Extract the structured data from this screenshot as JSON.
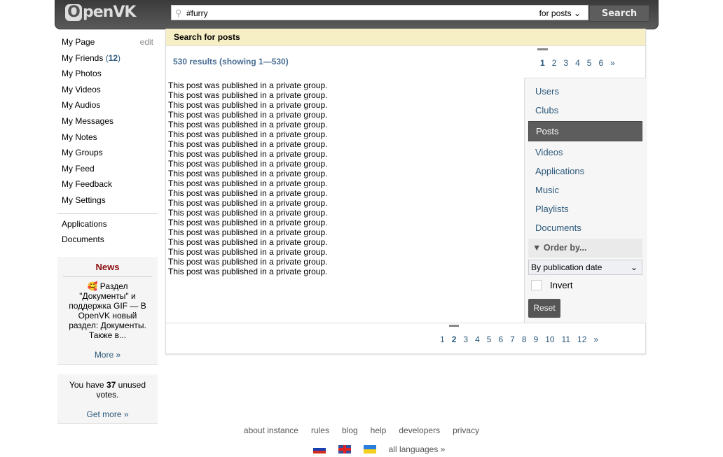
{
  "header": {
    "logo": "OpenVK",
    "search_value": "#furry",
    "search_scope": "for posts",
    "search_button": "Search"
  },
  "sidebar": {
    "items": [
      "My Page",
      "My Friends",
      "My Photos",
      "My Videos",
      "My Audios",
      "My Messages",
      "My Notes",
      "My Groups",
      "My Feed",
      "My Feedback",
      "My Settings"
    ],
    "edit": "edit",
    "friends_count": "12",
    "extra": [
      "Applications",
      "Documents"
    ]
  },
  "news": {
    "title": "News",
    "text": "🥰 Раздел \"Документы\" и поддержка GIF — В OpenVK новый раздел: Документы. Также в...",
    "more": "More »"
  },
  "votes": {
    "prefix": "You have",
    "count": "37",
    "suffix": "unused votes.",
    "more": "Get more »"
  },
  "main": {
    "title": "Search for posts",
    "count": "530 results (showing 1—530)",
    "top_pager": [
      "1",
      "2",
      "3",
      "4",
      "5",
      "6",
      "»"
    ],
    "top_current": "1",
    "bottom_pager": [
      "1",
      "2",
      "3",
      "4",
      "5",
      "6",
      "7",
      "8",
      "9",
      "10",
      "11",
      "12",
      "»"
    ],
    "bottom_current": "2",
    "posts": [
      "This post was published in a private group.",
      "This post was published in a private group.",
      "This post was published in a private group.",
      "This post was published in a private group.",
      "This post was published in a private group.",
      "This post was published in a private group.",
      "This post was published in a private group.",
      "This post was published in a private group.",
      "This post was published in a private group.",
      "This post was published in a private group.",
      "This post was published in a private group.",
      "This post was published in a private group.",
      "This post was published in a private group.",
      "This post was published in a private group.",
      "This post was published in a private group.",
      "This post was published in a private group.",
      "This post was published in a private group.",
      "This post was published in a private group.",
      "This post was published in a private group.",
      "This post was published in a private group."
    ]
  },
  "rnav": {
    "items": [
      "Users",
      "Clubs",
      "Posts",
      "Videos",
      "Applications",
      "Music",
      "Playlists",
      "Documents"
    ],
    "active": "Posts",
    "order_label": "Order by...",
    "order_value": "By publication date",
    "invert": "Invert",
    "reset": "Reset"
  },
  "footer": {
    "links": [
      "about instance",
      "rules",
      "blog",
      "help",
      "developers",
      "privacy"
    ],
    "languages": "all languages »"
  }
}
